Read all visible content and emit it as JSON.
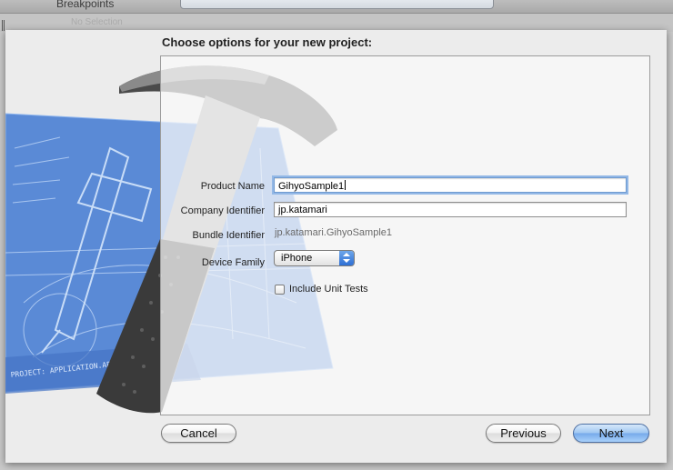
{
  "toolbar": {
    "breakpoints_label": "Breakpoints",
    "ghost_text": "No Selection"
  },
  "sheet": {
    "title": "Choose options for your new project:"
  },
  "form": {
    "product_name_label": "Product Name",
    "product_name_value": "GihyoSample1",
    "company_identifier_label": "Company Identifier",
    "company_identifier_value": "jp.katamari",
    "bundle_identifier_label": "Bundle Identifier",
    "bundle_identifier_value": "jp.katamari.GihyoSample1",
    "device_family_label": "Device Family",
    "device_family_value": "iPhone",
    "unit_tests_label": "Include Unit Tests",
    "unit_tests_checked": false
  },
  "buttons": {
    "cancel": "Cancel",
    "previous": "Previous",
    "next": "Next"
  },
  "art": {
    "blueprint_text": "PROJECT: APPLICATION.APP"
  },
  "colors": {
    "blueprint": "#4a7fd0",
    "accent_blue": "#3a78d8"
  }
}
